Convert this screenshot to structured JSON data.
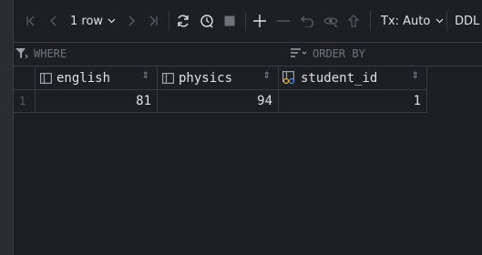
{
  "toolbar": {
    "rows_label": "1 row",
    "tx_label": "Tx: Auto",
    "ddl_label": "DDL"
  },
  "filter": {
    "where_label": "WHERE",
    "order_label": "ORDER BY"
  },
  "table": {
    "columns": [
      {
        "name": "english",
        "icon": "column-icon"
      },
      {
        "name": "physics",
        "icon": "column-icon"
      },
      {
        "name": "student_id",
        "icon": "key-column-icon"
      }
    ],
    "rows": [
      {
        "num": "1",
        "values": [
          "81",
          "94",
          "1"
        ]
      }
    ]
  }
}
